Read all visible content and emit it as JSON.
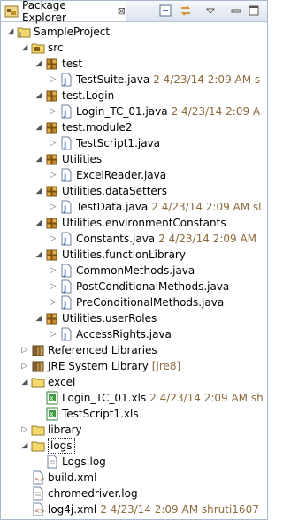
{
  "view": {
    "title": "Package Explorer",
    "close_glyph": "⊠",
    "toolbar": {
      "collapse_all_icon": "collapse-all-icon",
      "link_editor_icon": "link-with-editor-icon",
      "view_menu_icon": "view-menu-icon"
    }
  },
  "tree": [
    {
      "id": "sampleproject",
      "label": "SampleProject",
      "deco": "",
      "indent": 0,
      "expanded": true,
      "kind": "project"
    },
    {
      "id": "src",
      "label": "src",
      "deco": "",
      "indent": 1,
      "expanded": true,
      "kind": "srcfolder"
    },
    {
      "id": "pkg-test",
      "label": "test",
      "deco": "",
      "indent": 2,
      "expanded": true,
      "kind": "package"
    },
    {
      "id": "testsuite",
      "label": "TestSuite.java",
      "deco": "2  4/23/14 2:09 AM  s",
      "indent": 3,
      "expanded": false,
      "kind": "java"
    },
    {
      "id": "pkg-test-login",
      "label": "test.Login",
      "deco": "",
      "indent": 2,
      "expanded": true,
      "kind": "package"
    },
    {
      "id": "login-tc-01-java",
      "label": "Login_TC_01.java",
      "deco": "2  4/23/14 2:09 A",
      "indent": 3,
      "expanded": false,
      "kind": "java"
    },
    {
      "id": "pkg-test-module2",
      "label": "test.module2",
      "deco": "",
      "indent": 2,
      "expanded": true,
      "kind": "package"
    },
    {
      "id": "testscript1-java",
      "label": "TestScript1.java",
      "deco": "",
      "indent": 3,
      "expanded": false,
      "kind": "java"
    },
    {
      "id": "pkg-utilities",
      "label": "Utilities",
      "deco": "",
      "indent": 2,
      "expanded": true,
      "kind": "package"
    },
    {
      "id": "excelreader",
      "label": "ExcelReader.java",
      "deco": "",
      "indent": 3,
      "expanded": false,
      "kind": "java"
    },
    {
      "id": "pkg-datasetters",
      "label": "Utilities.dataSetters",
      "deco": "",
      "indent": 2,
      "expanded": true,
      "kind": "package"
    },
    {
      "id": "testdata",
      "label": "TestData.java",
      "deco": "2  4/23/14 2:09 AM  sl",
      "indent": 3,
      "expanded": false,
      "kind": "java"
    },
    {
      "id": "pkg-envconstants",
      "label": "Utilities.environmentConstants",
      "deco": "",
      "indent": 2,
      "expanded": true,
      "kind": "package"
    },
    {
      "id": "constants",
      "label": "Constants.java",
      "deco": "2  4/23/14 2:09 AM",
      "indent": 3,
      "expanded": false,
      "kind": "java"
    },
    {
      "id": "pkg-functionlibrary",
      "label": "Utilities.functionLibrary",
      "deco": "",
      "indent": 2,
      "expanded": true,
      "kind": "package"
    },
    {
      "id": "commonmethods",
      "label": "CommonMethods.java",
      "deco": "",
      "indent": 3,
      "expanded": false,
      "kind": "java"
    },
    {
      "id": "postconditional",
      "label": "PostConditionalMethods.java",
      "deco": "",
      "indent": 3,
      "expanded": false,
      "kind": "java"
    },
    {
      "id": "preconditional",
      "label": "PreConditionalMethods.java",
      "deco": "",
      "indent": 3,
      "expanded": false,
      "kind": "java"
    },
    {
      "id": "pkg-userroles",
      "label": "Utilities.userRoles",
      "deco": "",
      "indent": 2,
      "expanded": true,
      "kind": "package"
    },
    {
      "id": "accessrights",
      "label": "AccessRights.java",
      "deco": "",
      "indent": 3,
      "expanded": false,
      "kind": "java"
    },
    {
      "id": "referenced-libraries",
      "label": "Referenced Libraries",
      "deco": "",
      "indent": 1,
      "expanded": false,
      "kind": "libs"
    },
    {
      "id": "jre-system-library",
      "label": "JRE System Library",
      "deco": "[jre8]",
      "indent": 1,
      "expanded": false,
      "kind": "libs"
    },
    {
      "id": "excel",
      "label": "excel",
      "deco": "",
      "indent": 1,
      "expanded": true,
      "kind": "folder"
    },
    {
      "id": "login-tc-01-xls",
      "label": "Login_TC_01.xls",
      "deco": "2  4/23/14 2:09 AM  sh",
      "indent": 2,
      "expanded": null,
      "kind": "xls"
    },
    {
      "id": "testscript1-xls",
      "label": "TestScript1.xls",
      "deco": "",
      "indent": 2,
      "expanded": null,
      "kind": "xls"
    },
    {
      "id": "library",
      "label": "library",
      "deco": "",
      "indent": 1,
      "expanded": false,
      "kind": "folder"
    },
    {
      "id": "logs",
      "label": "logs",
      "deco": "",
      "indent": 1,
      "expanded": true,
      "kind": "folder",
      "selected": true
    },
    {
      "id": "logs-log",
      "label": "Logs.log",
      "deco": "",
      "indent": 2,
      "expanded": null,
      "kind": "file"
    },
    {
      "id": "build-xml",
      "label": "build.xml",
      "deco": "",
      "indent": 1,
      "expanded": null,
      "kind": "xml"
    },
    {
      "id": "chromedriver-log",
      "label": "chromedriver.log",
      "deco": "",
      "indent": 1,
      "expanded": null,
      "kind": "file"
    },
    {
      "id": "log4j-xml",
      "label": "log4j.xml",
      "deco": "2  4/23/14 2:09 AM  shruti1607",
      "indent": 1,
      "expanded": null,
      "kind": "xml"
    }
  ]
}
